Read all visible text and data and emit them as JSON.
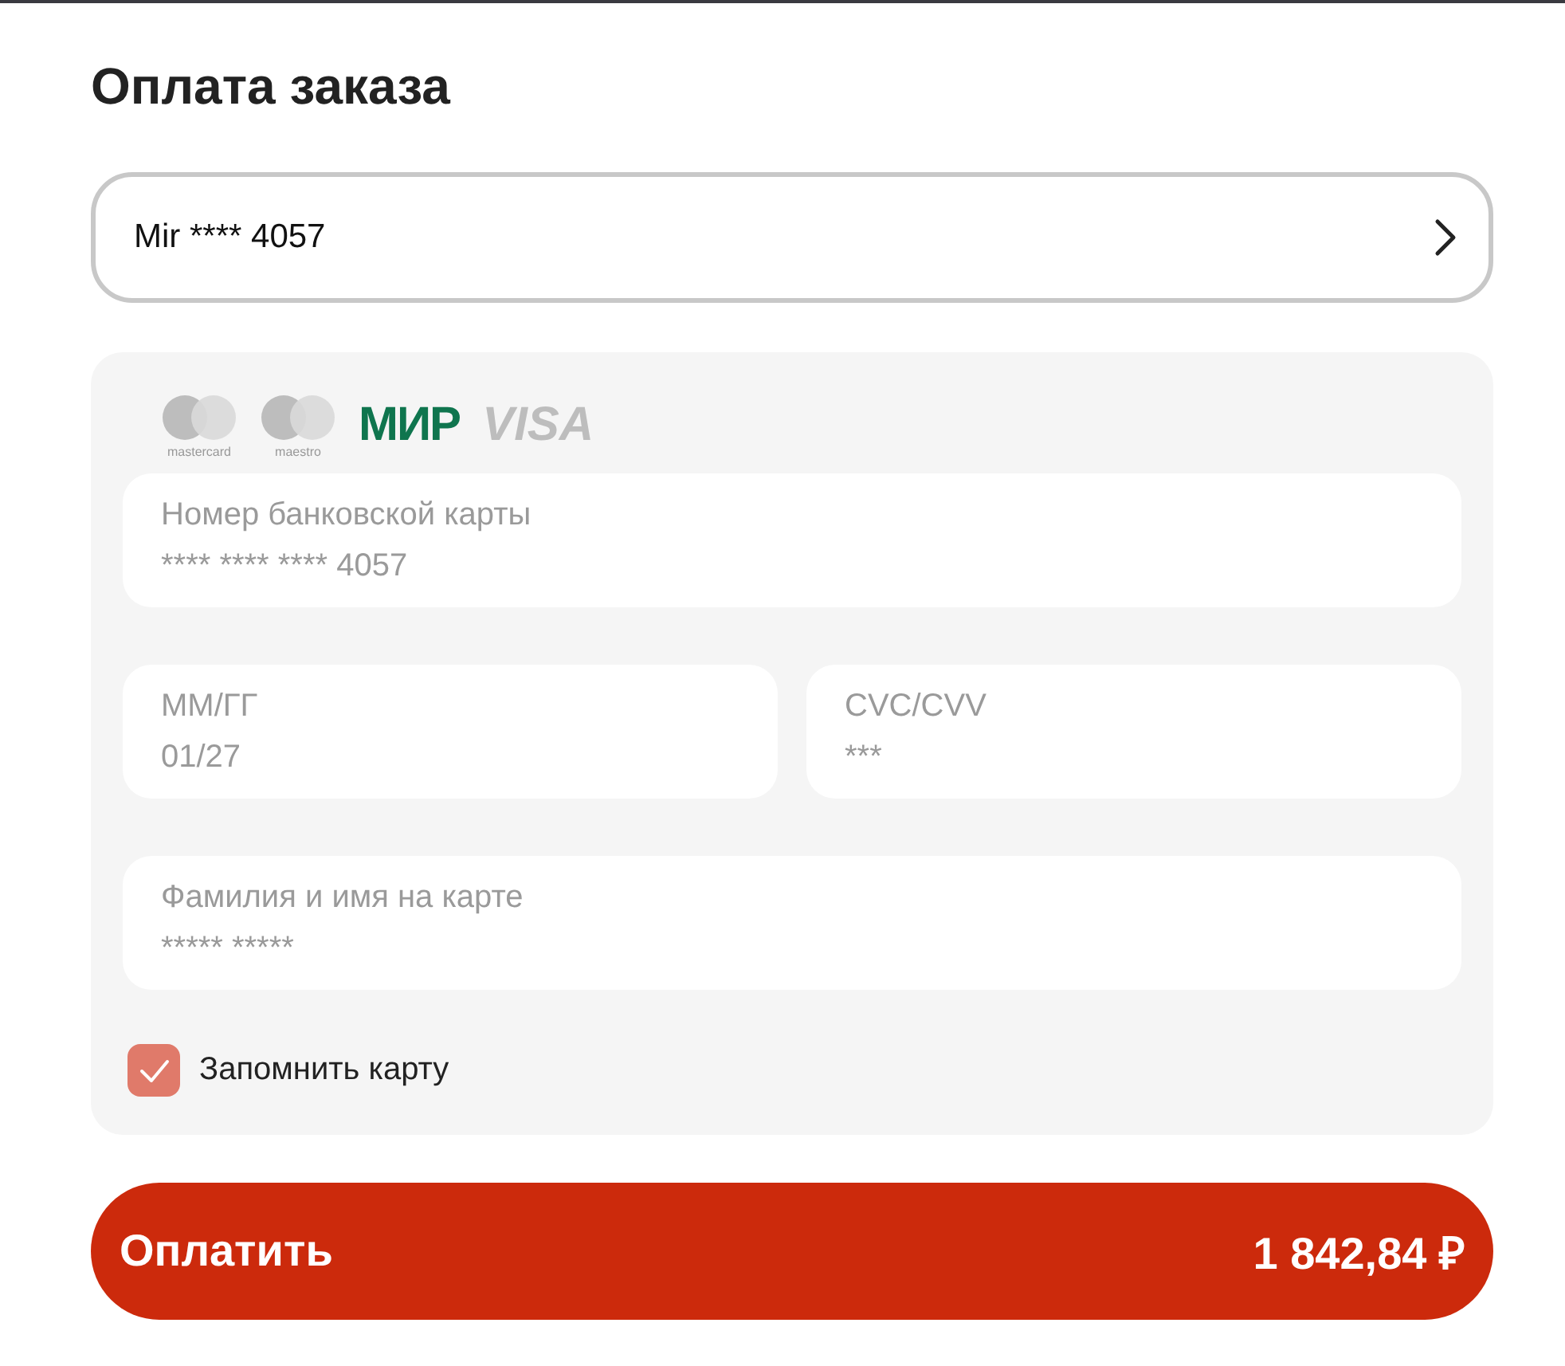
{
  "title": "Оплата заказа",
  "card_selector": {
    "value": "Mir **** 4057"
  },
  "card_brands": [
    {
      "kind": "mastercard",
      "label": "mastercard"
    },
    {
      "kind": "maestro",
      "label": "maestro"
    },
    {
      "kind": "mir",
      "label": "МИР"
    },
    {
      "kind": "visa",
      "label": "VISA"
    }
  ],
  "field_rows": [
    [
      {
        "label": "Номер банковской карты",
        "value": "**** **** **** 4057",
        "disabled": true
      }
    ],
    [
      {
        "label": "ММ/ГГ",
        "value": "01/27",
        "disabled": true
      },
      {
        "label": "CVC/CVV",
        "value": "***",
        "disabled": true
      }
    ],
    [
      {
        "label": "Фамилия и имя на карте",
        "value": "***** *****",
        "disabled": true
      }
    ]
  ],
  "remember_card": {
    "label": "Запомнить карту",
    "checked": true,
    "disabled": true
  },
  "pay_button": {
    "label": "Оплатить",
    "amount": "1 842,84 ₽"
  }
}
